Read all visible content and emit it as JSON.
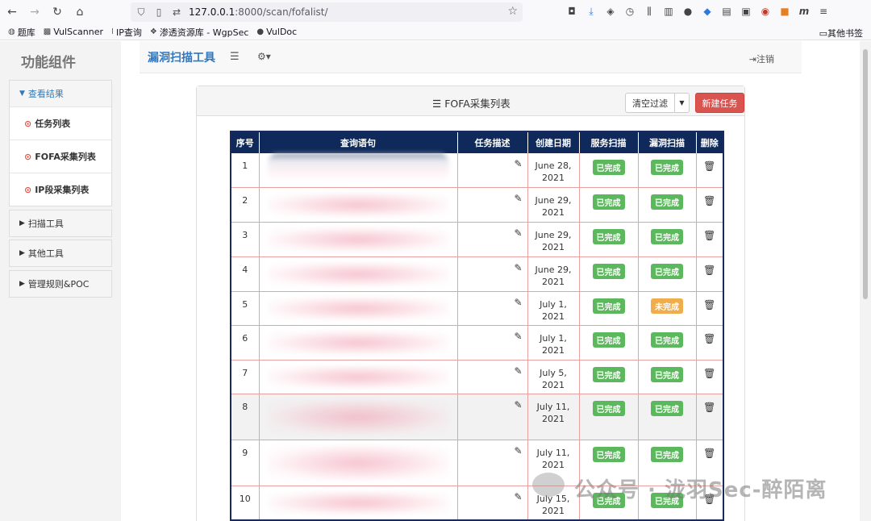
{
  "browser": {
    "url_host": "127.0.0.1",
    "url_path": ":8000/scan/fofalist/"
  },
  "bookmarks": [
    {
      "icon": "globe-icon",
      "label": "题库"
    },
    {
      "icon": "vulscanner-icon",
      "label": "VulScanner"
    },
    {
      "icon": "ip-icon",
      "label": "IP查询"
    },
    {
      "icon": "wgpsec-icon",
      "label": "渗透资源库 - WgpSec"
    },
    {
      "icon": "vuldoc-icon",
      "label": "VulDoc"
    }
  ],
  "bookmarks_other": "其他书签",
  "sidebar": {
    "title": "功能组件",
    "groups": [
      {
        "label": "查看结果",
        "active": true,
        "items": [
          "任务列表",
          "FOFA采集列表",
          "IP段采集列表"
        ]
      },
      {
        "label": "扫描工具",
        "active": false
      },
      {
        "label": "其他工具",
        "active": false
      },
      {
        "label": "管理规则&POC",
        "active": false
      }
    ]
  },
  "topnav": {
    "brand": "漏洞扫描工具",
    "logout": "注销"
  },
  "panel": {
    "title": "FOFA采集列表",
    "clear_filter": "清空过滤",
    "new_task": "新建任务"
  },
  "table": {
    "headers": [
      "序号",
      "查询语句",
      "任务描述",
      "创建日期",
      "服务扫描",
      "漏洞扫描",
      "删除"
    ],
    "rows": [
      {
        "seq": "1",
        "date": "June 28, 2021",
        "svc": "已完成",
        "vul": "已完成"
      },
      {
        "seq": "2",
        "date": "June 29, 2021",
        "svc": "已完成",
        "vul": "已完成"
      },
      {
        "seq": "3",
        "date": "June 29, 2021",
        "svc": "已完成",
        "vul": "已完成"
      },
      {
        "seq": "4",
        "date": "June 29, 2021",
        "svc": "已完成",
        "vul": "已完成"
      },
      {
        "seq": "5",
        "date": "July 1, 2021",
        "svc": "已完成",
        "vul": "未完成"
      },
      {
        "seq": "6",
        "date": "July 1, 2021",
        "svc": "已完成",
        "vul": "已完成"
      },
      {
        "seq": "7",
        "date": "July 5, 2021",
        "svc": "已完成",
        "vul": "已完成"
      },
      {
        "seq": "8",
        "date": "July 11, 2021",
        "svc": "已完成",
        "vul": "已完成"
      },
      {
        "seq": "9",
        "date": "July 11, 2021",
        "svc": "已完成",
        "vul": "已完成"
      },
      {
        "seq": "10",
        "date": "July 15, 2021",
        "svc": "已完成",
        "vul": "已完成"
      }
    ]
  },
  "colors": {
    "done": "#5cb85c",
    "pending": "#f0ad4e",
    "header_bg": "#0f2a5a",
    "danger": "#d9534f",
    "brand": "#3079c0"
  },
  "watermark": "公众号 · 泷羽Sec-醉陌离"
}
